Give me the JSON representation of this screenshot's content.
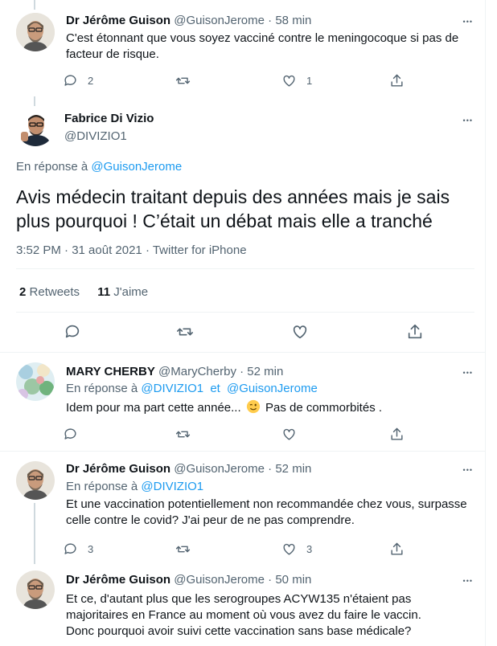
{
  "tweets": [
    {
      "name": "Dr Jérôme Guison",
      "handle": "@GuisonJerome",
      "time": "58 min",
      "text": "C'est étonnant que vous soyez vacciné contre le meningocoque si pas de facteur de risque.",
      "replies": "2",
      "retweets": "",
      "likes": "1"
    },
    {
      "name": "MARY CHERBY",
      "handle": "@MaryCherby",
      "time": "52 min",
      "reply_prefix": "En réponse à",
      "reply_to_1": "@DIVIZIO1",
      "reply_and": "et",
      "reply_to_2": "@GuisonJerome",
      "text_before_emoji": "Idem pour ma part cette année...",
      "text_after_emoji": "Pas de commorbités .",
      "emoji": "winking-face",
      "replies": "",
      "retweets": "",
      "likes": ""
    },
    {
      "name": "Dr Jérôme Guison",
      "handle": "@GuisonJerome",
      "time": "52 min",
      "reply_prefix": "En réponse à",
      "reply_to_1": "@DIVIZIO1",
      "text": "Et une vaccination potentiellement non recommandée chez vous, surpasse celle contre le covid? J'ai peur de ne pas comprendre.",
      "replies": "3",
      "retweets": "",
      "likes": "3"
    },
    {
      "name": "Dr Jérôme Guison",
      "handle": "@GuisonJerome",
      "time": "50 min",
      "text": "Et ce, d'autant plus que les serogroupes ACYW135 n'étaient pas majoritaires en France au moment où vous avez du faire le vaccin. Donc pourquoi avoir suivi cette vaccination sans base médicale?"
    }
  ],
  "main_tweet": {
    "name": "Fabrice Di Vizio",
    "handle": "@DIVIZIO1",
    "reply_prefix": "En réponse à",
    "reply_to": "@GuisonJerome",
    "text": "Avis médecin traitant depuis des années mais je sais plus pourquoi ! C’était un débat mais elle a tranché",
    "timestamp": "3:52 PM · 31 août 2021 · Twitter for iPhone",
    "retweets_count": "2",
    "retweets_label": "Retweets",
    "likes_count": "11",
    "likes_label": "J'aime"
  },
  "ui": {
    "more_glyph": "•••",
    "separator": "·"
  },
  "colors": {
    "link": "#1d9bf0",
    "secondary_text": "#536471",
    "primary_text": "#0f1419",
    "divider": "#eff3f4"
  }
}
